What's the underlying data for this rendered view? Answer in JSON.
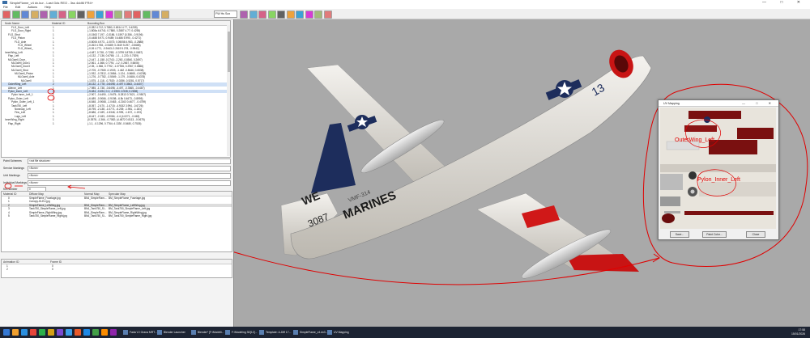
{
  "window": {
    "title": "SimpleFlame_v4 dx.kur - Last Gds REO - 3ss 4ddM FR4+"
  },
  "menu": [
    "File",
    "Edit",
    "Actions",
    "Help"
  ],
  "toolbar": {
    "zoom_value": "FW Hs Sox",
    "icons": [
      "new-file-icon",
      "open-folder-icon",
      "save-icon",
      "cut-icon",
      "copy-icon",
      "paste-icon",
      "undo-icon",
      "redo-icon",
      "grid-icon",
      "texture-icon",
      "node-icon",
      "mesh-icon",
      "camera-icon",
      "palette-icon",
      "material-icon",
      "light-icon",
      "render-icon",
      "red-icon",
      "color-icon",
      "sphere-icon",
      "cube-icon",
      "plane-icon",
      "wire-icon",
      "shade-icon",
      "uv-icon",
      "sky-icon",
      "ball-icon",
      "anim-icon"
    ]
  },
  "tree": {
    "columns": [
      "Node Name",
      "Material ID",
      "Bounding Box"
    ],
    "rows": [
      {
        "name": "FLG_Door_Left",
        "mat": "1",
        "bbox": "(-0.282 4.712; 0.7880, 0.6514 4.77, 0.4255)"
      },
      {
        "name": "FLG_Door_Right",
        "mat": "1",
        "bbox": "(-1.808a 4.6741; 0.7880, 0.2887 4.77; 0.4255)"
      },
      {
        "name": "FLG_Strut",
        "mat": "1",
        "bbox": "(-0.1563 7.197, -0.3186, 0.1597 (0.356, -0.9196)"
      },
      {
        "name": "FLG_Piston",
        "mat": "1",
        "bbox": "(-0.4488 5.971, 0.9489; 0.4486 5.990, -0.4271)"
      },
      {
        "name": "FLG_Axle",
        "mat": "1",
        "bbox": "(-0.8006 4.973, -1.0073; 0.05058 4.983, -0.2888)"
      },
      {
        "name": "FLG_Wheel",
        "mat": "1",
        "bbox": "(-0.263 4.758, -0.9489; 0.2619 5.297, -0.5685)"
      },
      {
        "name": "FLG_Wheel_",
        "mat": "1",
        "bbox": "(-0.26 4.771, -0.9443; 0.2619 5.278, -0.9542)"
      },
      {
        "name": "InnerWing_Left",
        "mat": "1",
        "bbox": "(-4.487, 0.738, -0.7282; -0.3799 0.8755, 0.0657)"
      },
      {
        "name": "Flap_Left",
        "mat": "1",
        "bbox": "(-4.132, -7.136, 0.6765; -1.1, -1.220, 0.7529)"
      },
      {
        "name": "MLGwell_Door_",
        "mat": "1",
        "bbox": "(-2.447, -1.158 -0.2743; -2.263 -0.8540, 0.2697)"
      },
      {
        "name": "MLGwell_Door1",
        "mat": "1",
        "bbox": "(-2.561, -1.566, 0.7791; -1.2, 0.2667, 0.6606)"
      },
      {
        "name": "MLGwell_Door3",
        "mat": "1",
        "bbox": "(-2.35, -1.566, 0.7792; -1.07926, 0.2967, 0.6866)"
      },
      {
        "name": "MLGwell_Strut",
        "mat": "1",
        "bbox": "(-2.705, -0.7965 -0.1903; -1.462 -0.8646, 0.6538)"
      },
      {
        "name": "MLGwell_Piston",
        "mat": "1",
        "bbox": "(-1.932, -0.7812, -0.3684; -1.124, -0.8665, -0.6238)"
      },
      {
        "name": "MLGwell_Axle",
        "mat": "1",
        "bbox": "(-1.276, -0.7782, -0.5549; -1.179, -0.8484, 0.6378)"
      },
      {
        "name": "MLGwell",
        "mat": "1",
        "bbox": "(-1.875, -1.118, -0.7520; -0.0286 -0.5281, 0.5717)"
      },
      {
        "name": "OuterWing_Left",
        "mat": "2",
        "bbox": "(-8.132, -1.778; -0.6498; -4.497 0.3563, -0.4407)",
        "selected": true
      },
      {
        "name": "Aileron_Left",
        "mat": "1",
        "bbox": "(-7.985, -1.738, -0.6498; -4.497, -0.3565, -0.4487)"
      },
      {
        "name": "Pylon_Inner_Left",
        "mat": "2",
        "bbox": "(-5.484, -0.494, 0.1; -2.1953 -0.928, 0.2698)",
        "selected": true
      },
      {
        "name": "Pylon Inner_Left_1",
        "mat": "1",
        "bbox": "(-2.907, -0.4490, -1.9475; -5.2813 0.7621, -0.9507)"
      },
      {
        "name": "Pylon_Outer_Left",
        "mat": "1",
        "bbox": "(-6.489, -0.9066, -0.9198; -6.5k 0.4673, -0.8995)"
      },
      {
        "name": "Pylon_Outer_Left_1",
        "mat": "1",
        "bbox": "(-6.848, -0.9068, -1.0463; -4.2163 0.4677, -0.4759)"
      },
      {
        "name": "Tank750_Left",
        "mat": "1",
        "bbox": "(-8.057, -2.470, -1.4715; -4.9152 3.994, -0.6726)"
      },
      {
        "name": "Nosecap_Left",
        "mat": "1",
        "bbox": "(-8.795, -2.138, -1.0771, -6.205; -1.981, -1.181)"
      },
      {
        "name": "Fins_Left",
        "mat": "1",
        "bbox": "(-8.686, -2.189, -1.5346; -5.995, -1.672, -1.193)"
      },
      {
        "name": "Lugs_Left",
        "mat": "1",
        "bbox": "(-8.447, -2.183, -0.9084; -4.4 (4.0271, -0.663)"
      },
      {
        "name": "InnerWing_Right",
        "mat": "1",
        "bbox": "(0.3978, -1.366, -0.7082; (4.4872 0.8113, -0.0675)"
      },
      {
        "name": "Flap_Right",
        "mat": "1",
        "bbox": "(-1.1, -0.1296, 0.7764; 4.1330 -0.5480, 0.7526)"
      }
    ]
  },
  "properties": [
    {
      "label": "Paint Schemes",
      "value": "<not file structure>"
    },
    {
      "label": "Service Markings",
      "value": "<None>"
    },
    {
      "label": "Unit Markings",
      "value": "<None>"
    },
    {
      "label": "Individual Markings",
      "value": "<None>"
    },
    {
      "label": "Kill Number",
      "value": "0"
    }
  ],
  "materials": {
    "columns": [
      "Material ID",
      "Diffuse Map",
      "Normal Map",
      "Specular Map"
    ],
    "rows": [
      {
        "id": "0",
        "diffuse": "SimpleFlame_Fuselage.jpg",
        "normal": "BN4_SimpleFlam...",
        "spec": "BM_SimpleFlame_Fuselage.jpg"
      },
      {
        "id": "1",
        "diffuse": "Canopy-DLEU.jpg",
        "normal": "",
        "spec": ""
      },
      {
        "id": "2",
        "diffuse": "SimpleFlame_LeftWing.jpg",
        "normal": "BN4_SimpleFlam...",
        "spec": "BM_SimpleFlame_LeftWing.jpg",
        "selected": true
      },
      {
        "id": "3",
        "diffuse": "Tank750_SimpleFlame_Left.jpg",
        "normal": "BN4_Tank750_Si...",
        "spec": "BM_Tank750_SimpleFlame_Left.jpg"
      },
      {
        "id": "4",
        "diffuse": "SimpleFlame_RightWing.jpg",
        "normal": "BN4_SimpleFlam...",
        "spec": "BM_SimpleFlame_RightWing.jpg"
      },
      {
        "id": "5",
        "diffuse": "Tank750_SimpleFlame_Right.jpg",
        "normal": "BN4_Tank750_Si...",
        "spec": "BM_Tank750_SimpleFlame_Right.jpg"
      }
    ]
  },
  "animation": {
    "columns": [
      "Animation ID",
      "Frame ID"
    ],
    "rows": [
      {
        "id": "1",
        "frame": "0"
      },
      {
        "id": "2",
        "frame": "0"
      }
    ]
  },
  "aircraft": {
    "tail_code": "13",
    "side_text": "MARINES",
    "serial": "3087",
    "unit_text": "VMF-314",
    "tail_letters": "WE"
  },
  "uv_dialog": {
    "title": "UV Mapping",
    "label_outer": "OuterWing_Left",
    "label_pylon": "Pylon_Inner_Left",
    "buttons": [
      "Save...",
      "Paint Color...",
      "Close"
    ]
  },
  "taskbar": {
    "tasks": [
      "Fada VJ Grana MRT...",
      "Blender Launcher",
      "Blender* [F:\\Modelli...",
      "F:\\Modeling 3D[12]...",
      "Template: A-Diff 17...",
      "SimpleFlame_v4.dx3...",
      "UV Mapping"
    ],
    "time": "17:58",
    "date": "15/01/2026",
    "colors": [
      "#3478d4",
      "#f0a030",
      "#2a8fe0",
      "#e5453a",
      "#2bb04a",
      "#d4a017",
      "#7a4ad0",
      "#3c9ee8",
      "#e85a2a",
      "#1e88e5",
      "#43a047",
      "#fb8c00",
      "#8e24aa"
    ]
  }
}
